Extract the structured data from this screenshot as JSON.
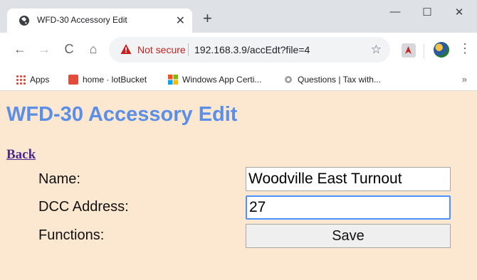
{
  "browser": {
    "tab": {
      "title": "WFD-30 Accessory Edit",
      "close_glyph": "✕",
      "favicon": "globe-icon"
    },
    "new_tab_glyph": "+",
    "window_controls": {
      "minimize": "—",
      "maximize": "☐",
      "close": "✕"
    },
    "toolbar": {
      "back": "←",
      "forward": "→",
      "reload": "C",
      "home": "⌂",
      "security_label": "Not secure",
      "url": "192.168.3.9/accEdt?file=4",
      "star": "☆",
      "menu": "⋮"
    },
    "bookmarks": [
      {
        "label": "Apps",
        "icon": "apps-grid-icon"
      },
      {
        "label": "home · lotBucket",
        "icon": "bookmark-site-icon"
      },
      {
        "label": "Windows App Certi...",
        "icon": "windows-logo-icon"
      },
      {
        "label": "Questions | Tax with...",
        "icon": "crest-icon"
      }
    ],
    "bookmarks_more": "»"
  },
  "page": {
    "title": "WFD-30 Accessory Edit",
    "back_link": "Back",
    "form": {
      "name_label": "Name:",
      "name_value": "Woodville East Turnout",
      "dcc_label": "DCC Address:",
      "dcc_value": "27",
      "functions_label": "Functions:",
      "save_label": "Save"
    }
  },
  "colors": {
    "page_background": "#fce8d0",
    "title": "#5b8ee6",
    "link": "#4e2a8e",
    "focus_ring": "#4d90fe",
    "not_secure": "#c5221f"
  }
}
